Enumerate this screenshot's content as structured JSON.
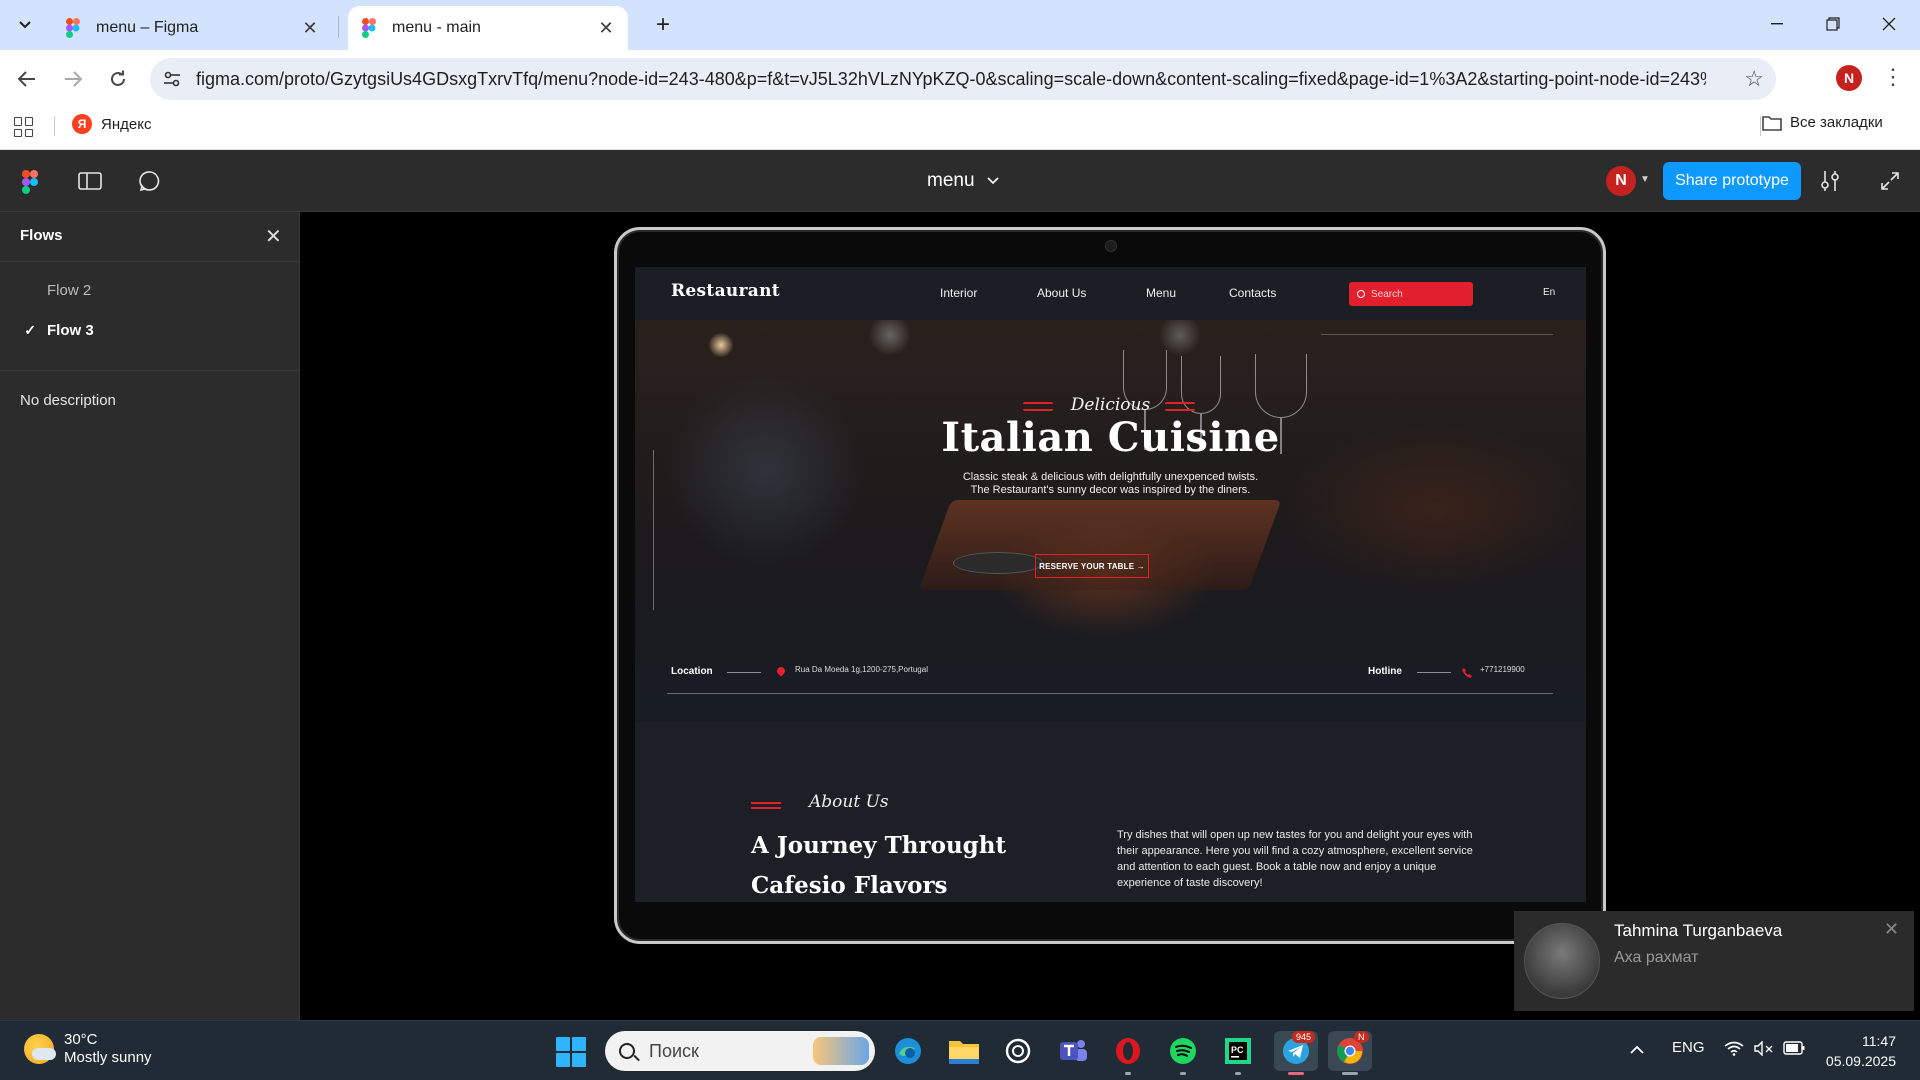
{
  "browser": {
    "tabs": [
      {
        "title": "menu – Figma"
      },
      {
        "title": "menu - main"
      }
    ],
    "url": "figma.com/proto/GzytgsiUs4GDsxgTxrvTfq/menu?node-id=243-480&p=f&t=vJ5L32hVLzNYpKZQ-0&scaling=scale-down&content-scaling=fixed&page-id=1%3A2&starting-point-node-id=243%3A480...",
    "profile_initial": "N",
    "bookmarks": {
      "yandex": "Яндекс",
      "all": "Все закладки"
    }
  },
  "figma": {
    "file_title": "menu",
    "avatar_initial": "N",
    "share_label": "Share prototype",
    "flows": {
      "title": "Flows",
      "items": [
        {
          "label": "Flow 2",
          "selected": false
        },
        {
          "label": "Flow 3",
          "selected": true
        }
      ],
      "description": "No description"
    }
  },
  "site": {
    "logo": "Restaurant",
    "nav": [
      "Interior",
      "About Us",
      "Menu",
      "Contacts"
    ],
    "search_placeholder": "Search",
    "lang": "En",
    "hero": {
      "script": "Delicious",
      "title": "Italian Cuisine",
      "subtitle_line1": "Classic steak & delicious with delightfully unexpenced twists.",
      "subtitle_line2": "The Restaurant's sunny decor was inspired by the diners.",
      "cta": "RESERVE YOUR TABLE →",
      "location_label": "Location",
      "location_value": "Rua Da Moeda 1g,1200-275,Portugal",
      "hotline_label": "Hotline",
      "hotline_value": "+771219900"
    },
    "about": {
      "script": "About Us",
      "title_line1": "A Journey Throught",
      "title_line2": "Cafesio Flavors",
      "text": "Try dishes that will open up new tastes for you and delight your eyes with their appearance. Here you will find a cozy atmosphere, excellent service and attention to each guest. Book a table now and enjoy a unique experience of taste discovery!"
    }
  },
  "notification": {
    "name": "Tahmina Turganbaeva",
    "message": "Аха рахмат"
  },
  "taskbar": {
    "weather_temp": "30°C",
    "weather_cond": "Mostly sunny",
    "search_placeholder": "Поиск",
    "telegram_badge": "945",
    "chrome_badge": "N",
    "lang": "ENG",
    "time": "11:47",
    "date": "05.09.2025"
  },
  "colors": {
    "accent_red": "#e21f2c",
    "figma_blue": "#0d99ff",
    "tab_bar": "#d3e3fd"
  }
}
